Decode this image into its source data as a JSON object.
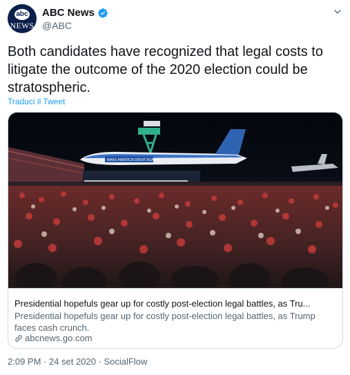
{
  "account": {
    "display_name": "ABC News",
    "handle": "@ABC",
    "avatar_top": "abc",
    "avatar_bottom": "NEWS",
    "verified": true
  },
  "tweet": {
    "text": "Both candidates have recognized that legal costs to litigate the outcome of the 2020 election could be stratospheric.",
    "translate_label": "Traduci il Tweet"
  },
  "card": {
    "image_banner": "MAKE AMERICA GREAT AGAIN!",
    "title": "Presidential hopefuls gear up for costly post-election legal battles, as Tru...",
    "description": "Presidential hopefuls gear up for costly post-election legal battles, as Trump faces cash crunch.",
    "domain": "abcnews.go.com"
  },
  "meta": {
    "time": "2:09 PM",
    "separator": " · ",
    "date": "24 set 2020",
    "source": "SocialFlow"
  },
  "colors": {
    "accent": "#1d9bf0",
    "secondary_text": "#536471",
    "border": "#cfd9de",
    "avatar_bg": "#0b1f4a"
  },
  "icons": [
    "verified-badge-icon",
    "chevron-down-icon",
    "link-icon"
  ]
}
